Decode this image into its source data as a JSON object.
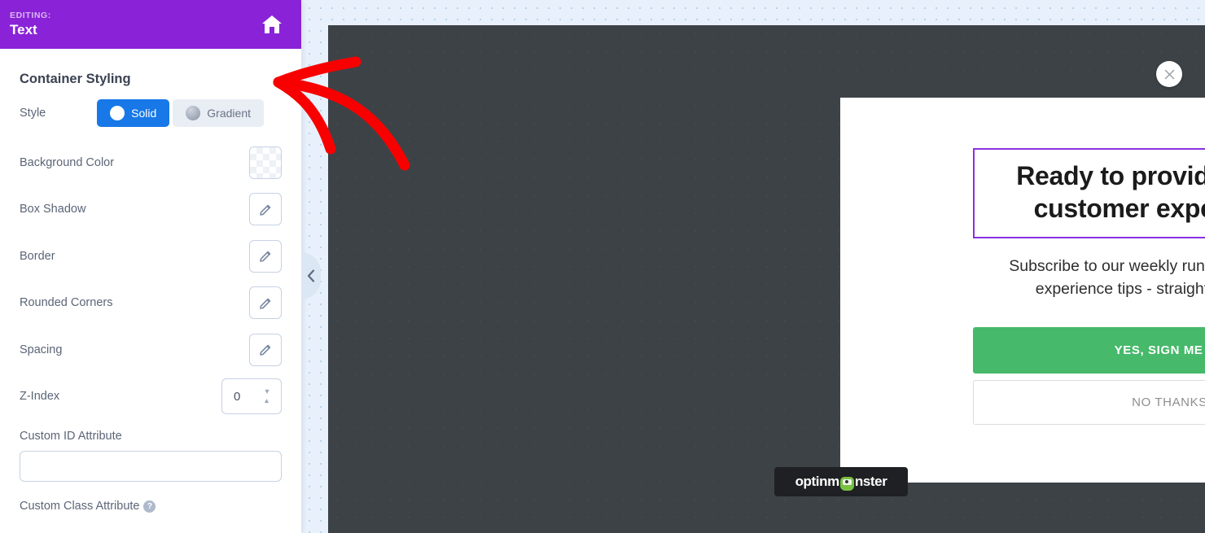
{
  "sidebar": {
    "header": {
      "editing_label": "EDITING:",
      "editing_value": "Text",
      "home_icon": "home-icon"
    },
    "panel_title": "Container Styling",
    "style_row": {
      "label": "Style",
      "options": [
        {
          "label": "Solid",
          "active": true
        },
        {
          "label": "Gradient",
          "active": false
        }
      ]
    },
    "rows": [
      {
        "label": "Background Color",
        "control": "color-swatch",
        "value": "transparent"
      },
      {
        "label": "Box Shadow",
        "control": "edit-pencil"
      },
      {
        "label": "Border",
        "control": "edit-pencil"
      },
      {
        "label": "Rounded Corners",
        "control": "edit-pencil"
      },
      {
        "label": "Spacing",
        "control": "edit-pencil"
      }
    ],
    "zindex": {
      "label": "Z-Index",
      "value": "0"
    },
    "custom_id": {
      "label": "Custom ID Attribute",
      "value": "",
      "placeholder": ""
    },
    "custom_class": {
      "label": "Custom Class Attribute",
      "help_icon": "question-mark-icon"
    },
    "collapse_handle": {
      "icon": "chevron-left-icon"
    }
  },
  "canvas": {
    "close_button": {
      "icon": "close-x-icon"
    },
    "popup": {
      "headline": "Ready to provide a better customer experience?",
      "subheadline": "Subscribe to our weekly rundown of customer experience tips - straight to your inbox",
      "primary_cta": "YES, SIGN ME UP",
      "secondary_cta": "NO THANKS"
    },
    "branding_badge": {
      "text_before": "optinm",
      "text_after": "nster",
      "icon": "monster-logo-icon"
    }
  },
  "annotation": {
    "type": "red-arrow",
    "color": "#f80000",
    "points_to": "Container Styling"
  },
  "colors": {
    "header_purple": "#8a23d7",
    "accent_blue": "#1878e8",
    "selection_purple": "#8b2fe0",
    "cta_green": "#46b96a",
    "canvas_dark": "#3d4247",
    "annotation_red": "#f80000"
  }
}
